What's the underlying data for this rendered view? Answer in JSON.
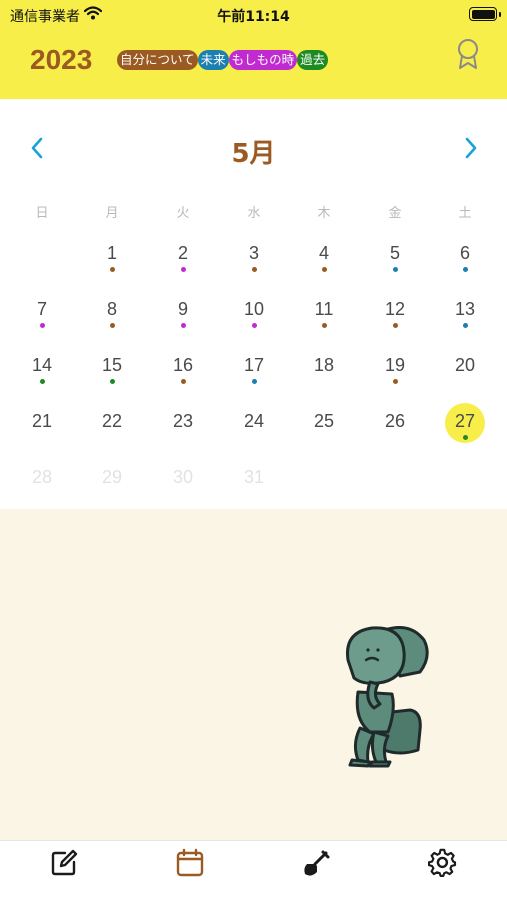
{
  "status_bar": {
    "carrier": "通信事業者",
    "time": "午前11:14"
  },
  "header": {
    "year": "2023",
    "tags": [
      {
        "label": "自分について",
        "color": "#9a5a22"
      },
      {
        "label": "未来",
        "color": "#1d7fb0"
      },
      {
        "label": "もしもの時",
        "color": "#c12ad0"
      },
      {
        "label": "過去",
        "color": "#1d8a22"
      }
    ],
    "award_icon": "award-ribbon-icon"
  },
  "calendar": {
    "month": "5月",
    "prev_icon": "chevron-left-icon",
    "next_icon": "chevron-right-icon",
    "weekdays": [
      "日",
      "月",
      "火",
      "水",
      "木",
      "金",
      "土"
    ],
    "days": [
      {
        "label": "1",
        "col": 1,
        "row": 0,
        "dot": "#9a5a22"
      },
      {
        "label": "2",
        "col": 2,
        "row": 0,
        "dot": "#c12ad0"
      },
      {
        "label": "3",
        "col": 3,
        "row": 0,
        "dot": "#9a5a22"
      },
      {
        "label": "4",
        "col": 4,
        "row": 0,
        "dot": "#9a5a22"
      },
      {
        "label": "5",
        "col": 5,
        "row": 0,
        "dot": "#1d7fb0"
      },
      {
        "label": "6",
        "col": 6,
        "row": 0,
        "dot": "#1d7fb0"
      },
      {
        "label": "7",
        "col": 0,
        "row": 1,
        "dot": "#c12ad0"
      },
      {
        "label": "8",
        "col": 1,
        "row": 1,
        "dot": "#9a5a22"
      },
      {
        "label": "9",
        "col": 2,
        "row": 1,
        "dot": "#c12ad0"
      },
      {
        "label": "10",
        "col": 3,
        "row": 1,
        "dot": "#c12ad0"
      },
      {
        "label": "11",
        "col": 4,
        "row": 1,
        "dot": "#9a5a22"
      },
      {
        "label": "12",
        "col": 5,
        "row": 1,
        "dot": "#9a5a22"
      },
      {
        "label": "13",
        "col": 6,
        "row": 1,
        "dot": "#1d7fb0"
      },
      {
        "label": "14",
        "col": 0,
        "row": 2,
        "dot": "#1d8a22"
      },
      {
        "label": "15",
        "col": 1,
        "row": 2,
        "dot": "#1d8a22"
      },
      {
        "label": "16",
        "col": 2,
        "row": 2,
        "dot": "#9a5a22"
      },
      {
        "label": "17",
        "col": 3,
        "row": 2,
        "dot": "#1d7fb0"
      },
      {
        "label": "18",
        "col": 4,
        "row": 2,
        "dot": null
      },
      {
        "label": "19",
        "col": 5,
        "row": 2,
        "dot": "#9a5a22"
      },
      {
        "label": "20",
        "col": 6,
        "row": 2,
        "dot": null
      },
      {
        "label": "21",
        "col": 0,
        "row": 3,
        "dot": null
      },
      {
        "label": "22",
        "col": 1,
        "row": 3,
        "dot": null
      },
      {
        "label": "23",
        "col": 2,
        "row": 3,
        "dot": null
      },
      {
        "label": "24",
        "col": 3,
        "row": 3,
        "dot": null
      },
      {
        "label": "25",
        "col": 4,
        "row": 3,
        "dot": null
      },
      {
        "label": "26",
        "col": 5,
        "row": 3,
        "dot": null
      },
      {
        "label": "27",
        "col": 6,
        "row": 3,
        "dot": "#1d8a22",
        "selected": true
      },
      {
        "label": "28",
        "col": 0,
        "row": 4,
        "dot": null,
        "other": true
      },
      {
        "label": "29",
        "col": 1,
        "row": 4,
        "dot": null,
        "other": true
      },
      {
        "label": "30",
        "col": 2,
        "row": 4,
        "dot": null,
        "other": true
      },
      {
        "label": "31",
        "col": 3,
        "row": 4,
        "dot": null,
        "other": true
      }
    ]
  },
  "tab_bar": {
    "items": [
      {
        "icon": "edit-icon",
        "active": false
      },
      {
        "icon": "calendar-icon",
        "active": true
      },
      {
        "icon": "shovel-icon",
        "active": false
      },
      {
        "icon": "gear-icon",
        "active": false
      }
    ]
  },
  "character": "thinker-statue-illustration",
  "colors": {
    "header_bg": "#f8ee4a",
    "accent_brown": "#9a5a22",
    "chevron_blue": "#1aa3d8",
    "page_bg": "#fbf5e6"
  }
}
